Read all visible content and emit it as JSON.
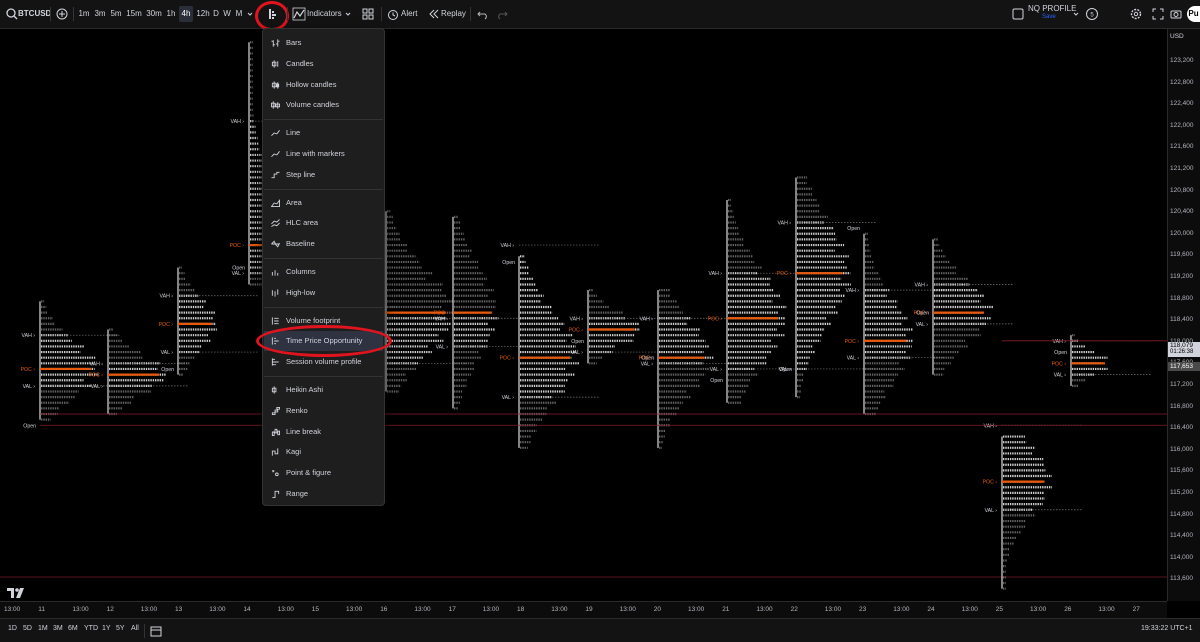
{
  "toolbar": {
    "symbol": "BTCUSD",
    "timeframes": [
      "1m",
      "3m",
      "5m",
      "15m",
      "30m",
      "1h",
      "4h",
      "12h",
      "D",
      "W",
      "M"
    ],
    "active_timeframe": "4h",
    "indicators_label": "Indicators",
    "alert_label": "Alert",
    "replay_label": "Replay",
    "layout_name": "NQ PROFILE",
    "save_label": "Save",
    "publish_label": "Pu"
  },
  "chart_type_menu": {
    "groups": [
      [
        {
          "label": "Bars",
          "icon": "bars-icon"
        },
        {
          "label": "Candles",
          "icon": "candles-icon"
        },
        {
          "label": "Hollow candles",
          "icon": "hollow-candles-icon"
        },
        {
          "label": "Volume candles",
          "icon": "volume-candles-icon"
        }
      ],
      [
        {
          "label": "Line",
          "icon": "line-icon"
        },
        {
          "label": "Line with markers",
          "icon": "line-markers-icon"
        },
        {
          "label": "Step line",
          "icon": "step-line-icon"
        }
      ],
      [
        {
          "label": "Area",
          "icon": "area-icon"
        },
        {
          "label": "HLC area",
          "icon": "hlc-area-icon"
        },
        {
          "label": "Baseline",
          "icon": "baseline-icon"
        }
      ],
      [
        {
          "label": "Columns",
          "icon": "columns-icon"
        },
        {
          "label": "High-low",
          "icon": "high-low-icon"
        }
      ],
      [
        {
          "label": "Volume footprint",
          "icon": "volume-footprint-icon"
        },
        {
          "label": "Time Price Opportunity",
          "icon": "tpo-icon",
          "selected": true
        },
        {
          "label": "Session volume profile",
          "icon": "session-volume-profile-icon"
        }
      ],
      [
        {
          "label": "Heikin Ashi",
          "icon": "heikin-ashi-icon"
        },
        {
          "label": "Renko",
          "icon": "renko-icon"
        },
        {
          "label": "Line break",
          "icon": "line-break-icon"
        },
        {
          "label": "Kagi",
          "icon": "kagi-icon"
        },
        {
          "label": "Point & figure",
          "icon": "point-figure-icon"
        },
        {
          "label": "Range",
          "icon": "range-icon"
        }
      ]
    ]
  },
  "price_axis": {
    "currency": "USD",
    "labels": [
      "123,200",
      "122,800",
      "122,400",
      "122,000",
      "121,600",
      "121,200",
      "120,800",
      "120,400",
      "120,000",
      "119,600",
      "119,200",
      "118,800",
      "118,400",
      "118,000",
      "117,600",
      "117,200",
      "116,800",
      "116,400",
      "116,000",
      "115,600",
      "115,200",
      "114,800",
      "114,400",
      "114,000",
      "113,600"
    ],
    "last_price": "118,079",
    "countdown": "01:26:38",
    "marker_price": "117,653"
  },
  "time_axis": {
    "labels": [
      "13:00",
      "11",
      "13:00",
      "12",
      "13:00",
      "13",
      "13:00",
      "14",
      "13:00",
      "15",
      "13:00",
      "16",
      "13:00",
      "17",
      "13:00",
      "18",
      "13:00",
      "19",
      "13:00",
      "20",
      "13:00",
      "21",
      "13:00",
      "22",
      "13:00",
      "23",
      "13:00",
      "24",
      "13:00",
      "25",
      "13:00",
      "26",
      "13:00",
      "27"
    ]
  },
  "bottom_bar": {
    "ranges": [
      "1D",
      "5D",
      "1M",
      "3M",
      "6M",
      "YTD",
      "1Y",
      "5Y",
      "All"
    ],
    "clock": "19:33:22 UTC+1"
  },
  "tpo_labels": {
    "vah": "VAH",
    "poc": "POC",
    "val": "VAL",
    "open": "Open"
  },
  "colors": {
    "poc": "#e8590c",
    "profile": "#ffffff",
    "accent": "#2962ff",
    "highlight_circle": "#e0141e"
  },
  "chart_data": {
    "type": "tpo",
    "y_unit": "USD",
    "ylim": [
      113600,
      123400
    ],
    "sessions": [
      {
        "day": "11",
        "vah": 118000,
        "poc": 117400,
        "val": 117100,
        "open": 116400
      },
      {
        "day": "12",
        "vah": 117500,
        "poc": 117300,
        "val": 117100
      },
      {
        "day": "13",
        "vah": 118700,
        "poc": 118200,
        "val": 117700,
        "open": 117400
      },
      {
        "day": "14",
        "vah": 121800,
        "poc": 119600,
        "val": 119100,
        "open": 119200
      },
      {
        "day": "15",
        "vah": 118500,
        "poc": 118400,
        "val": 117500
      },
      {
        "day": "16",
        "vah": 118300,
        "poc": 118400,
        "val": 117500
      },
      {
        "day": "17",
        "vah": 118300,
        "poc": 118400,
        "val": 117800
      },
      {
        "day": "18",
        "vah": 119600,
        "poc": 117600,
        "val": 116900,
        "open": 119300
      },
      {
        "day": "19",
        "vah": 118300,
        "poc": 118100,
        "val": 117700,
        "open": 117900
      },
      {
        "day": "20",
        "vah": 118300,
        "poc": 117600,
        "val": 117500,
        "open": 117600
      },
      {
        "day": "21",
        "vah": 119100,
        "poc": 118300,
        "val": 117400,
        "open": 117200
      },
      {
        "day": "22",
        "vah": 120000,
        "poc": 119100,
        "val": 117400,
        "open": 117400
      },
      {
        "day": "23",
        "vah": 118800,
        "poc": 117900,
        "val": 117600,
        "open": 119900
      },
      {
        "day": "24",
        "vah": 118900,
        "poc": 118400,
        "val": 118200,
        "open": 118400
      },
      {
        "day": "25",
        "vah": 116400,
        "poc": 115400,
        "val": 114900
      },
      {
        "day": "26",
        "vah": 117900,
        "poc": 117500,
        "val": 117300,
        "open": 117700
      }
    ]
  }
}
